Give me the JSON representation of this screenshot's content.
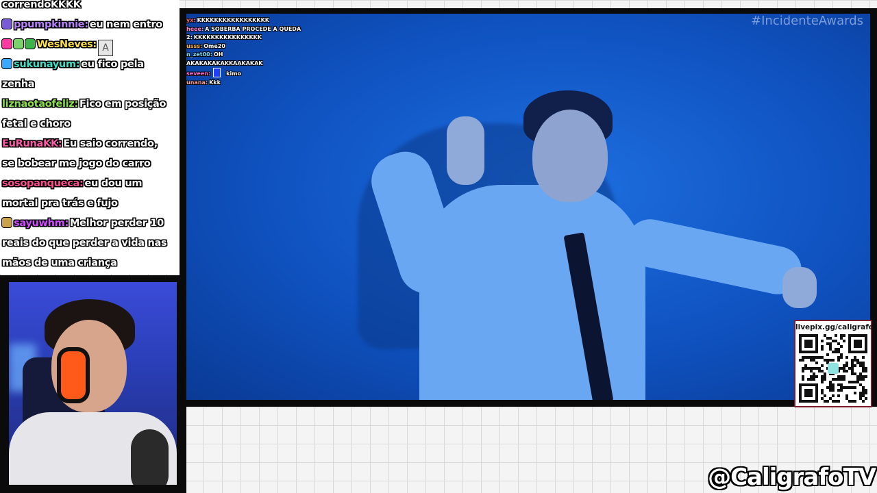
{
  "chat": {
    "messages": [
      {
        "user": "",
        "user_color": "#ffffff",
        "text": "correndoKKKK",
        "badges": []
      },
      {
        "user": "ppumpkinnie:",
        "user_color": "#b983ff",
        "text": "eu nem entro",
        "badges": [
          "#7a5bd6"
        ]
      },
      {
        "user": "WesNeves:",
        "user_color": "#ffe34d",
        "text": "",
        "badges": [
          "#ff3aa0",
          "#7bd16c",
          "#3fb34a"
        ],
        "emote": "A"
      },
      {
        "user": "sukunayum:",
        "user_color": "#3fe0c8",
        "text": "eu fico pela",
        "badges": [
          "#3aa8ff"
        ]
      },
      {
        "user": "",
        "user_color": "#ffffff",
        "text": "zenha",
        "badges": []
      },
      {
        "user": "liznaotaofeliz:",
        "user_color": "#8be04a",
        "text": "Fico em posição",
        "badges": []
      },
      {
        "user": "",
        "user_color": "#ffffff",
        "text": "fetal e choro",
        "badges": []
      },
      {
        "user": "EuRunaKK:",
        "user_color": "#ff5aa8",
        "text": "Eu saio correndo,",
        "badges": []
      },
      {
        "user": "",
        "user_color": "#ffffff",
        "text": "se bobear me jogo do carro",
        "badges": []
      },
      {
        "user": "sosopanqueca:",
        "user_color": "#ff4d8f",
        "text": "eu dou um",
        "badges": []
      },
      {
        "user": "",
        "user_color": "#ffffff",
        "text": "mortal pra trás e fujo",
        "badges": []
      },
      {
        "user": "sayuwhm:",
        "user_color": "#d24dff",
        "text": "Melhor perder 10",
        "badges": [
          "#c9a24a"
        ]
      },
      {
        "user": "",
        "user_color": "#ffffff",
        "text": "reais do que perder a vida nas",
        "badges": []
      },
      {
        "user": "",
        "user_color": "#ffffff",
        "text": "mãos de uma criança",
        "badges": []
      }
    ]
  },
  "video": {
    "hashtag": "#IncidenteAwards",
    "overlay_chat": [
      {
        "user": "yx:",
        "user_color": "#ff6b6b",
        "text": "KKKKKKKKKKKKKKKKK"
      },
      {
        "user": "heee:",
        "user_color": "#ff7fd1",
        "text": "A SOBERBA PROCEDE A QUEDA"
      },
      {
        "user": "2:",
        "user_color": "#ffffff",
        "text": "KKKKKKKKKKKKKKKK"
      },
      {
        "user": "usss:",
        "user_color": "#ffb347",
        "text": "Ome20"
      },
      {
        "user": "n_zet00:",
        "user_color": "#7ee0ff",
        "text": "OH"
      },
      {
        "user": "",
        "user_color": "#ffffff",
        "text": "AKAKAKAKAKKAAKAKAK"
      },
      {
        "user": "seveen:",
        "user_color": "#ff6bd3",
        "text": "kimo",
        "emote": true
      },
      {
        "user": "unana:",
        "user_color": "#ffa0a0",
        "text": "Kkk"
      }
    ]
  },
  "qr": {
    "label": "livepix.gg/caligrafo"
  },
  "brand": {
    "handle": "@CaligrafoTV"
  },
  "colors": {
    "frame": "#0a0a0a",
    "video_blue": "#0f52c0",
    "qr_border": "#7a1a2a"
  }
}
